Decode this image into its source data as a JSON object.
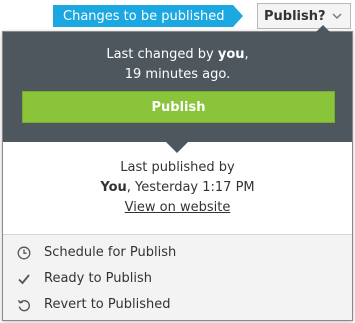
{
  "status_tag": {
    "label": "Changes to be published",
    "color": "#1ba7e0"
  },
  "publish_toggle": {
    "label": "Publish?",
    "icon": "chevron-down-icon"
  },
  "panel": {
    "last_changed_prefix": "Last changed by ",
    "last_changed_user": "you",
    "last_changed_suffix": ",",
    "last_changed_time": "19 minutes ago.",
    "publish_button": "Publish",
    "publish_button_color": "#89c43a",
    "last_published_label": "Last published by",
    "last_published_user": "You",
    "last_published_time": ", Yesterday 1:17 PM",
    "view_link": "View on website"
  },
  "menu": {
    "items": [
      {
        "label": "Schedule for Publish",
        "icon": "clock-icon"
      },
      {
        "label": "Ready to Publish",
        "icon": "checkmark-icon"
      },
      {
        "label": "Revert to Published",
        "icon": "revert-icon"
      }
    ]
  }
}
